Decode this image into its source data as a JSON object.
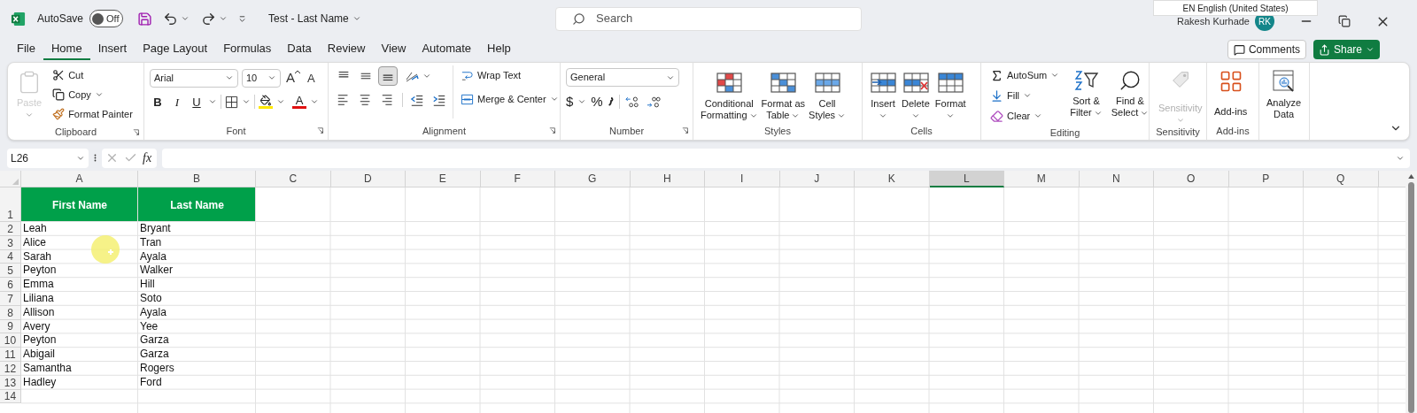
{
  "title_bar": {
    "autosave": {
      "label": "AutoSave",
      "on": false,
      "state_text": "Off"
    },
    "document_title": "Test - Last Name",
    "search": {
      "placeholder": "Search"
    },
    "language_popup": "EN English (United States)",
    "user": {
      "name": "Rakesh Kurhade",
      "initials": "RK"
    }
  },
  "menu_tabs": [
    {
      "label": "File",
      "selected": false
    },
    {
      "label": "Home",
      "selected": true
    },
    {
      "label": "Insert",
      "selected": false
    },
    {
      "label": "Page Layout",
      "selected": false
    },
    {
      "label": "Formulas",
      "selected": false
    },
    {
      "label": "Data",
      "selected": false
    },
    {
      "label": "Review",
      "selected": false
    },
    {
      "label": "View",
      "selected": false
    },
    {
      "label": "Automate",
      "selected": false
    },
    {
      "label": "Help",
      "selected": false
    }
  ],
  "comments_button": "Comments",
  "share_button": "Share",
  "ribbon": {
    "groups": [
      {
        "kind": "clipboard",
        "label": "Clipboard",
        "paste": {
          "label": "Paste",
          "disabled": true
        },
        "items": [
          "Cut",
          "Copy",
          "Format Painter"
        ]
      },
      {
        "kind": "font",
        "label": "Font",
        "font_name": "Arial",
        "font_size": "10",
        "grow": "A",
        "shrink": "A",
        "styles": [
          "B",
          "I",
          "U"
        ],
        "font_color": "A"
      },
      {
        "kind": "alignment",
        "label": "Alignment",
        "vertical": [
          {
            "selected": false
          },
          {
            "selected": false
          },
          {
            "selected": true
          }
        ],
        "wrap": "Wrap Text",
        "merge": "Merge & Center"
      },
      {
        "kind": "number",
        "label": "Number",
        "format": "General",
        "currency": "$",
        "percent": "%"
      },
      {
        "kind": "styles",
        "label": "Styles",
        "items": [
          [
            "Conditional",
            "Formatting"
          ],
          [
            "Format as",
            "Table"
          ],
          [
            "Cell",
            "Styles"
          ]
        ]
      },
      {
        "kind": "cells",
        "label": "Cells",
        "items": [
          "Insert",
          "Delete",
          "Format"
        ]
      },
      {
        "kind": "editing",
        "label": "Editing",
        "items": [
          "AutoSum",
          "Fill",
          "Clear"
        ],
        "large": [
          [
            "Sort &",
            "Filter"
          ],
          [
            "Find &",
            "Select"
          ]
        ]
      },
      {
        "kind": "sensitivity",
        "label": "Sensitivity",
        "button": "Sensitivity",
        "disabled": true
      },
      {
        "kind": "addins",
        "label": "Add-ins",
        "button": "Add-ins"
      },
      {
        "kind": "analyze",
        "button": [
          "Analyze",
          "Data"
        ]
      }
    ]
  },
  "formula_bar": {
    "name_box": "L26",
    "function_label": "fx"
  },
  "sheet": {
    "columns": [
      {
        "label": "A",
        "selected": false
      },
      {
        "label": "B",
        "selected": false
      },
      {
        "label": "C",
        "selected": false
      },
      {
        "label": "D",
        "selected": false
      },
      {
        "label": "E",
        "selected": false
      },
      {
        "label": "F",
        "selected": false
      },
      {
        "label": "G",
        "selected": false
      },
      {
        "label": "H",
        "selected": false
      },
      {
        "label": "I",
        "selected": false
      },
      {
        "label": "J",
        "selected": false
      },
      {
        "label": "K",
        "selected": false
      },
      {
        "label": "L",
        "selected": true
      },
      {
        "label": "M",
        "selected": false
      },
      {
        "label": "N",
        "selected": false
      },
      {
        "label": "O",
        "selected": false
      },
      {
        "label": "P",
        "selected": false
      },
      {
        "label": "Q",
        "selected": false
      }
    ],
    "rows": [
      {
        "number": "1",
        "kind": "header",
        "cells": [
          "First Name",
          "Last Name"
        ]
      },
      {
        "number": "2",
        "kind": "data",
        "cells": [
          "Leah",
          "Bryant"
        ]
      },
      {
        "number": "3",
        "kind": "data",
        "cells": [
          "Alice",
          "Tran"
        ]
      },
      {
        "number": "4",
        "kind": "data",
        "cells": [
          "Sarah",
          "Ayala"
        ]
      },
      {
        "number": "5",
        "kind": "data",
        "cells": [
          "Peyton",
          "Walker"
        ]
      },
      {
        "number": "6",
        "kind": "data",
        "cells": [
          "Emma",
          "Hill"
        ]
      },
      {
        "number": "7",
        "kind": "data",
        "cells": [
          "Liliana",
          "Soto"
        ]
      },
      {
        "number": "8",
        "kind": "data",
        "cells": [
          "Allison",
          "Ayala"
        ]
      },
      {
        "number": "9",
        "kind": "data",
        "cells": [
          "Avery",
          "Yee"
        ]
      },
      {
        "number": "10",
        "kind": "data",
        "cells": [
          "Peyton",
          "Garza"
        ]
      },
      {
        "number": "11",
        "kind": "data",
        "cells": [
          "Abigail",
          "Garza"
        ]
      },
      {
        "number": "12",
        "kind": "data",
        "cells": [
          "Samantha",
          "Rogers"
        ]
      },
      {
        "number": "13",
        "kind": "data",
        "cells": [
          "Hadley",
          "Ford"
        ]
      },
      {
        "number": "14",
        "kind": "data"
      }
    ]
  }
}
